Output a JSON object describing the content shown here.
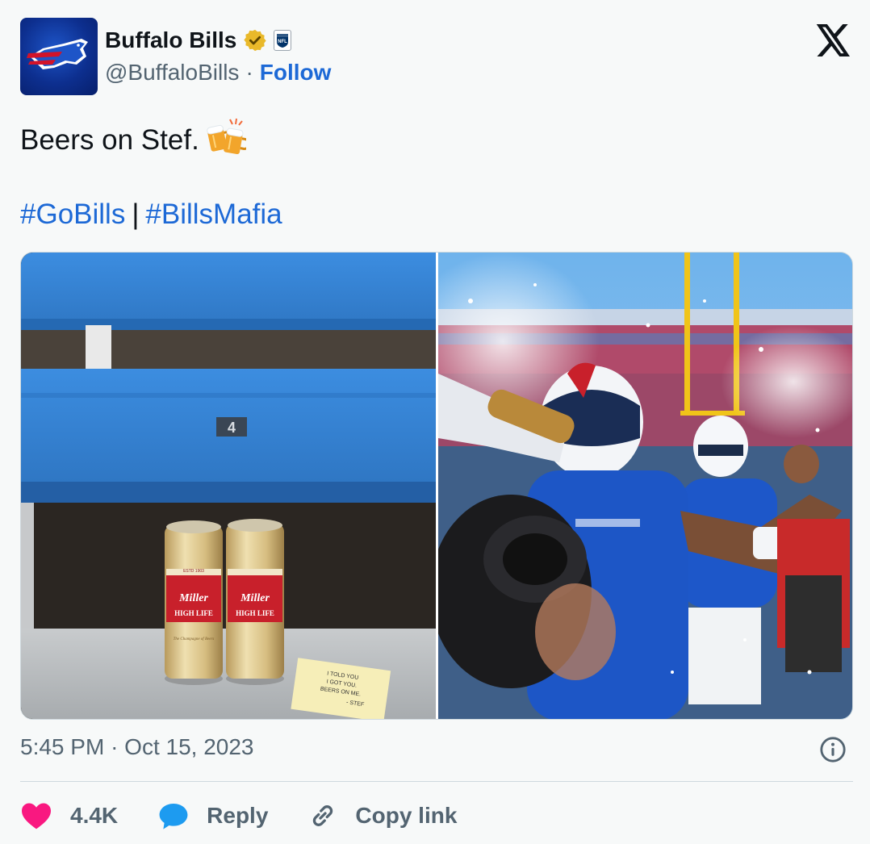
{
  "account": {
    "name": "Buffalo Bills",
    "handle": "@BuffaloBills",
    "separator": "·",
    "follow_label": "Follow",
    "verified_color": "#e9b92a",
    "brand_color": "#0d2f8f"
  },
  "tweet": {
    "text": "Beers on Stef.",
    "emoji": "clinking-beer-mugs",
    "hashtags": [
      "#GoBills",
      "#BillsMafia"
    ],
    "hashtag_separator": "|"
  },
  "media": {
    "left_photo": {
      "seat_number": "4",
      "can_labels": [
        "ESTD 1903",
        "Miller",
        "HIGH LIFE",
        "The Champagne of Beers"
      ],
      "note_lines": [
        "I TOLD YOU",
        "I GOT YOU.",
        "BEERS ON ME.",
        "- STEF"
      ]
    },
    "right_photo": {
      "subject": "player celebration spraying beer"
    }
  },
  "meta": {
    "time": "5:45 PM",
    "separator": "·",
    "date": "Oct 15, 2023"
  },
  "actions": {
    "like_count": "4.4K",
    "reply_label": "Reply",
    "copy_label": "Copy link"
  },
  "colors": {
    "link": "#1d69d6",
    "like": "#f91880",
    "reply": "#1d9bf0",
    "muted": "#536471"
  }
}
